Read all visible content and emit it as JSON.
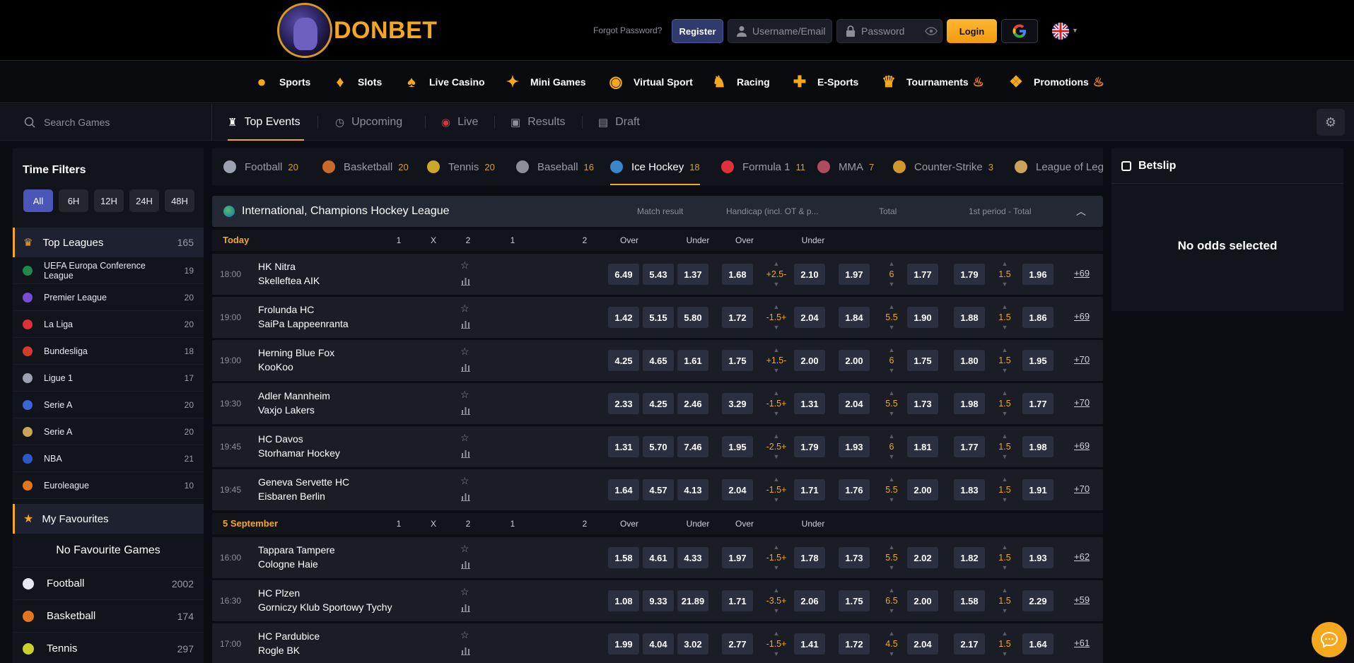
{
  "brand": {
    "logo_text": "DONBET"
  },
  "auth": {
    "forgot": "Forgot Password?",
    "register": "Register",
    "username_placeholder": "Username/Email",
    "password_placeholder": "Password",
    "login": "Login"
  },
  "categories": [
    "Sports",
    "Slots",
    "Live Casino",
    "Mini Games",
    "Virtual Sport",
    "Racing",
    "E-Sports",
    "Tournaments",
    "Promotions"
  ],
  "search_placeholder": "Search Games",
  "tabs": [
    "Top Events",
    "Upcoming",
    "Live",
    "Results",
    "Draft"
  ],
  "sidebar": {
    "time_filters_title": "Time Filters",
    "time_filters": [
      "All",
      "6H",
      "12H",
      "24H",
      "48H"
    ],
    "top_leagues": {
      "label": "Top Leagues",
      "count": "165"
    },
    "leagues": [
      {
        "name": "UEFA Europa Conference League",
        "count": "19",
        "color": "#1f8a4c"
      },
      {
        "name": "Premier League",
        "count": "20",
        "color": "#7b4bd6"
      },
      {
        "name": "La Liga",
        "count": "20",
        "color": "#e0303a"
      },
      {
        "name": "Bundesliga",
        "count": "18",
        "color": "#d33b2a"
      },
      {
        "name": "Ligue 1",
        "count": "17",
        "color": "#9ba1b0"
      },
      {
        "name": "Serie A",
        "count": "20",
        "color": "#3a66d6"
      },
      {
        "name": "Serie A",
        "count": "20",
        "color": "#c9a45a"
      },
      {
        "name": "NBA",
        "count": "21",
        "color": "#2b59c9"
      },
      {
        "name": "Euroleague",
        "count": "10",
        "color": "#e3761f"
      }
    ],
    "favourites_label": "My Favourites",
    "no_favourites": "No Favourite Games",
    "sports": [
      {
        "name": "Football",
        "count": "2002"
      },
      {
        "name": "Basketball",
        "count": "174"
      },
      {
        "name": "Tennis",
        "count": "297"
      }
    ]
  },
  "sports_tabs": [
    {
      "name": "Football",
      "count": "20"
    },
    {
      "name": "Basketball",
      "count": "20"
    },
    {
      "name": "Tennis",
      "count": "20"
    },
    {
      "name": "Baseball",
      "count": "16"
    },
    {
      "name": "Ice Hockey",
      "count": "18"
    },
    {
      "name": "Formula 1",
      "count": "11"
    },
    {
      "name": "MMA",
      "count": "7"
    },
    {
      "name": "Counter-Strike",
      "count": "3"
    },
    {
      "name": "League of Legends",
      "count": ""
    }
  ],
  "league_title": "International, Champions Hockey League",
  "market_headers": [
    "Match result",
    "Handicap (incl. OT & p...",
    "Total",
    "1st period - Total"
  ],
  "column_headers": [
    "1",
    "X",
    "2",
    "1",
    "2",
    "Over",
    "Under",
    "Over",
    "Under"
  ],
  "sections": [
    {
      "date": "Today",
      "matches": [
        {
          "time": "18:00",
          "home": "HK Nitra",
          "away": "Skelleftea AIK",
          "odds": [
            "6.49",
            "5.43",
            "1.37",
            "1.68",
            "2.10",
            "1.97",
            "1.77",
            "1.79",
            "1.96"
          ],
          "hcp": "+2.5-",
          "total": "6",
          "p1": "1.5",
          "more": "+69"
        },
        {
          "time": "19:00",
          "home": "Frolunda HC",
          "away": "SaiPa Lappeenranta",
          "odds": [
            "1.42",
            "5.15",
            "5.80",
            "1.72",
            "2.04",
            "1.84",
            "1.90",
            "1.88",
            "1.86"
          ],
          "hcp": "-1.5+",
          "total": "5.5",
          "p1": "1.5",
          "more": "+69"
        },
        {
          "time": "19:00",
          "home": "Herning Blue Fox",
          "away": "KooKoo",
          "odds": [
            "4.25",
            "4.65",
            "1.61",
            "1.75",
            "2.00",
            "2.00",
            "1.75",
            "1.80",
            "1.95"
          ],
          "hcp": "+1.5-",
          "total": "6",
          "p1": "1.5",
          "more": "+70"
        },
        {
          "time": "19:30",
          "home": "Adler Mannheim",
          "away": "Vaxjo Lakers",
          "odds": [
            "2.33",
            "4.25",
            "2.46",
            "3.29",
            "1.31",
            "2.04",
            "1.73",
            "1.98",
            "1.77"
          ],
          "hcp": "-1.5+",
          "total": "5.5",
          "p1": "1.5",
          "more": "+70"
        },
        {
          "time": "19:45",
          "home": "HC Davos",
          "away": "Storhamar Hockey",
          "odds": [
            "1.31",
            "5.70",
            "7.46",
            "1.95",
            "1.79",
            "1.93",
            "1.81",
            "1.77",
            "1.98"
          ],
          "hcp": "-2.5+",
          "total": "6",
          "p1": "1.5",
          "more": "+69"
        },
        {
          "time": "19:45",
          "home": "Geneva Servette HC",
          "away": "Eisbaren Berlin",
          "odds": [
            "1.64",
            "4.57",
            "4.13",
            "2.04",
            "1.71",
            "1.76",
            "2.00",
            "1.83",
            "1.91"
          ],
          "hcp": "-1.5+",
          "total": "5.5",
          "p1": "1.5",
          "more": "+70"
        }
      ]
    },
    {
      "date": "5 September",
      "matches": [
        {
          "time": "16:00",
          "home": "Tappara Tampere",
          "away": "Cologne Haie",
          "odds": [
            "1.58",
            "4.61",
            "4.33",
            "1.97",
            "1.78",
            "1.73",
            "2.02",
            "1.82",
            "1.93"
          ],
          "hcp": "-1.5+",
          "total": "5.5",
          "p1": "1.5",
          "more": "+62"
        },
        {
          "time": "16:30",
          "home": "HC Plzen",
          "away": "Gorniczy Klub Sportowy Tychy",
          "odds": [
            "1.08",
            "9.33",
            "21.89",
            "1.71",
            "2.06",
            "1.75",
            "2.00",
            "1.58",
            "2.29"
          ],
          "hcp": "-3.5+",
          "total": "6.5",
          "p1": "1.5",
          "more": "+59"
        },
        {
          "time": "17:00",
          "home": "HC Pardubice",
          "away": "Rogle BK",
          "odds": [
            "1.99",
            "4.04",
            "3.02",
            "2.77",
            "1.41",
            "1.72",
            "2.04",
            "2.17",
            "1.64"
          ],
          "hcp": "-1.5+",
          "total": "4.5",
          "p1": "1.5",
          "more": "+61"
        }
      ]
    }
  ],
  "betslip": {
    "title": "Betslip",
    "empty": "No odds selected"
  },
  "colors": {
    "accent": "#f5a81e",
    "primary": "#4a57b8",
    "panel": "#12141b"
  }
}
